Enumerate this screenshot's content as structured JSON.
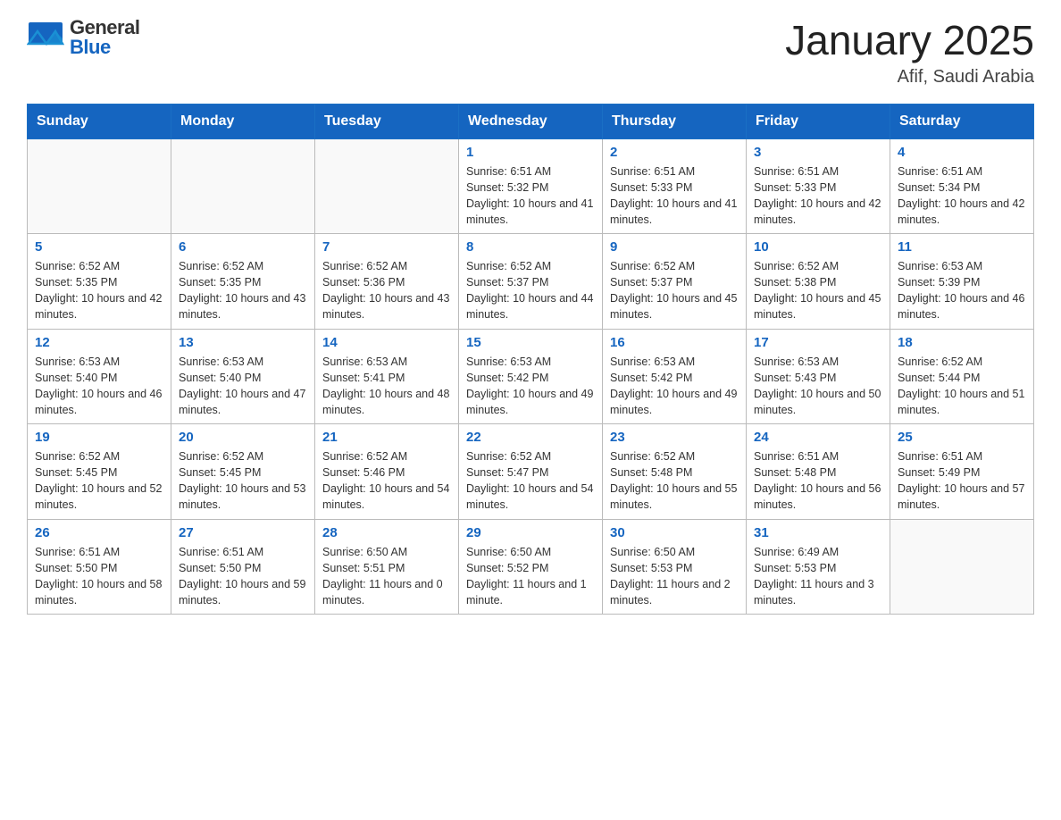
{
  "header": {
    "title": "January 2025",
    "subtitle": "Afif, Saudi Arabia"
  },
  "days_of_week": [
    "Sunday",
    "Monday",
    "Tuesday",
    "Wednesday",
    "Thursday",
    "Friday",
    "Saturday"
  ],
  "weeks": [
    [
      {
        "day": "",
        "info": ""
      },
      {
        "day": "",
        "info": ""
      },
      {
        "day": "",
        "info": ""
      },
      {
        "day": "1",
        "info": "Sunrise: 6:51 AM\nSunset: 5:32 PM\nDaylight: 10 hours and 41 minutes."
      },
      {
        "day": "2",
        "info": "Sunrise: 6:51 AM\nSunset: 5:33 PM\nDaylight: 10 hours and 41 minutes."
      },
      {
        "day": "3",
        "info": "Sunrise: 6:51 AM\nSunset: 5:33 PM\nDaylight: 10 hours and 42 minutes."
      },
      {
        "day": "4",
        "info": "Sunrise: 6:51 AM\nSunset: 5:34 PM\nDaylight: 10 hours and 42 minutes."
      }
    ],
    [
      {
        "day": "5",
        "info": "Sunrise: 6:52 AM\nSunset: 5:35 PM\nDaylight: 10 hours and 42 minutes."
      },
      {
        "day": "6",
        "info": "Sunrise: 6:52 AM\nSunset: 5:35 PM\nDaylight: 10 hours and 43 minutes."
      },
      {
        "day": "7",
        "info": "Sunrise: 6:52 AM\nSunset: 5:36 PM\nDaylight: 10 hours and 43 minutes."
      },
      {
        "day": "8",
        "info": "Sunrise: 6:52 AM\nSunset: 5:37 PM\nDaylight: 10 hours and 44 minutes."
      },
      {
        "day": "9",
        "info": "Sunrise: 6:52 AM\nSunset: 5:37 PM\nDaylight: 10 hours and 45 minutes."
      },
      {
        "day": "10",
        "info": "Sunrise: 6:52 AM\nSunset: 5:38 PM\nDaylight: 10 hours and 45 minutes."
      },
      {
        "day": "11",
        "info": "Sunrise: 6:53 AM\nSunset: 5:39 PM\nDaylight: 10 hours and 46 minutes."
      }
    ],
    [
      {
        "day": "12",
        "info": "Sunrise: 6:53 AM\nSunset: 5:40 PM\nDaylight: 10 hours and 46 minutes."
      },
      {
        "day": "13",
        "info": "Sunrise: 6:53 AM\nSunset: 5:40 PM\nDaylight: 10 hours and 47 minutes."
      },
      {
        "day": "14",
        "info": "Sunrise: 6:53 AM\nSunset: 5:41 PM\nDaylight: 10 hours and 48 minutes."
      },
      {
        "day": "15",
        "info": "Sunrise: 6:53 AM\nSunset: 5:42 PM\nDaylight: 10 hours and 49 minutes."
      },
      {
        "day": "16",
        "info": "Sunrise: 6:53 AM\nSunset: 5:42 PM\nDaylight: 10 hours and 49 minutes."
      },
      {
        "day": "17",
        "info": "Sunrise: 6:53 AM\nSunset: 5:43 PM\nDaylight: 10 hours and 50 minutes."
      },
      {
        "day": "18",
        "info": "Sunrise: 6:52 AM\nSunset: 5:44 PM\nDaylight: 10 hours and 51 minutes."
      }
    ],
    [
      {
        "day": "19",
        "info": "Sunrise: 6:52 AM\nSunset: 5:45 PM\nDaylight: 10 hours and 52 minutes."
      },
      {
        "day": "20",
        "info": "Sunrise: 6:52 AM\nSunset: 5:45 PM\nDaylight: 10 hours and 53 minutes."
      },
      {
        "day": "21",
        "info": "Sunrise: 6:52 AM\nSunset: 5:46 PM\nDaylight: 10 hours and 54 minutes."
      },
      {
        "day": "22",
        "info": "Sunrise: 6:52 AM\nSunset: 5:47 PM\nDaylight: 10 hours and 54 minutes."
      },
      {
        "day": "23",
        "info": "Sunrise: 6:52 AM\nSunset: 5:48 PM\nDaylight: 10 hours and 55 minutes."
      },
      {
        "day": "24",
        "info": "Sunrise: 6:51 AM\nSunset: 5:48 PM\nDaylight: 10 hours and 56 minutes."
      },
      {
        "day": "25",
        "info": "Sunrise: 6:51 AM\nSunset: 5:49 PM\nDaylight: 10 hours and 57 minutes."
      }
    ],
    [
      {
        "day": "26",
        "info": "Sunrise: 6:51 AM\nSunset: 5:50 PM\nDaylight: 10 hours and 58 minutes."
      },
      {
        "day": "27",
        "info": "Sunrise: 6:51 AM\nSunset: 5:50 PM\nDaylight: 10 hours and 59 minutes."
      },
      {
        "day": "28",
        "info": "Sunrise: 6:50 AM\nSunset: 5:51 PM\nDaylight: 11 hours and 0 minutes."
      },
      {
        "day": "29",
        "info": "Sunrise: 6:50 AM\nSunset: 5:52 PM\nDaylight: 11 hours and 1 minute."
      },
      {
        "day": "30",
        "info": "Sunrise: 6:50 AM\nSunset: 5:53 PM\nDaylight: 11 hours and 2 minutes."
      },
      {
        "day": "31",
        "info": "Sunrise: 6:49 AM\nSunset: 5:53 PM\nDaylight: 11 hours and 3 minutes."
      },
      {
        "day": "",
        "info": ""
      }
    ]
  ]
}
